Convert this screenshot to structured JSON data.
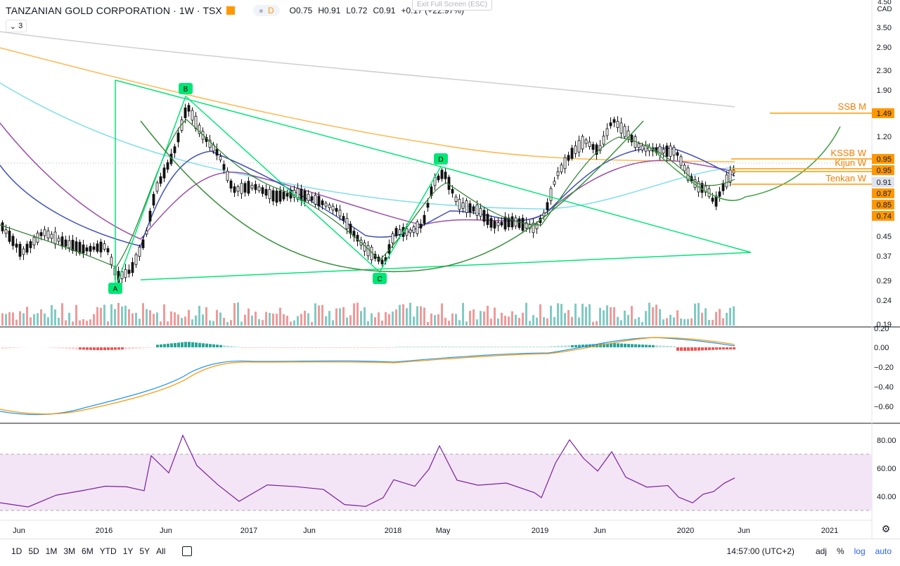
{
  "header": {
    "symbol": "TANZANIAN GOLD CORPORATION",
    "interval": "1W",
    "exchange": "TSX",
    "delay_badge": "D",
    "open_label": "O",
    "open": "0.75",
    "high_label": "H",
    "high": "0.91",
    "low_label": "L",
    "low": "0.72",
    "close_label": "C",
    "close": "0.91",
    "change": "+0.17 (+22.97%)",
    "collapse_count": "3"
  },
  "exit_fullscreen": "Exit Full Screen (ESC)",
  "price_axis": {
    "currency": "CAD",
    "top_label": "4.50",
    "ticks": [
      "3.50",
      "2.90",
      "2.30",
      "1.90",
      "1.49",
      "1.20",
      "0.95",
      "0.95",
      "0.91",
      "0.87",
      "0.85",
      "0.74",
      "0.45",
      "0.37",
      "0.29",
      "0.24",
      "0.19"
    ]
  },
  "level_labels": [
    {
      "text": "SSB M",
      "color": "#f57c00"
    },
    {
      "text": "KSSB W",
      "color": "#f57c00"
    },
    {
      "text": "Kijun W",
      "color": "#f57c00"
    },
    {
      "text": "Tenkan W",
      "color": "#f57c00"
    }
  ],
  "price_badges": [
    {
      "text": "1.49",
      "bg": "#ff9800",
      "fg": "#000"
    },
    {
      "text": "0.95",
      "bg": "#ff9800",
      "fg": "#000"
    },
    {
      "text": "0.95",
      "bg": "#ff9800",
      "fg": "#000"
    },
    {
      "text": "0.91",
      "bg": "#e0e3eb",
      "fg": "#131722"
    },
    {
      "text": "0.87",
      "bg": "#ff9800",
      "fg": "#000"
    },
    {
      "text": "0.85",
      "bg": "#ff9800",
      "fg": "#000"
    },
    {
      "text": "0.74",
      "bg": "#ff9800",
      "fg": "#000"
    }
  ],
  "macd_axis": [
    "0.20",
    "0.00",
    "−0.20",
    "−0.40",
    "−0.60"
  ],
  "rsi_axis": [
    "80.00",
    "60.00",
    "40.00"
  ],
  "time_axis": [
    "Jun",
    "2016",
    "Jun",
    "2017",
    "Jun",
    "2018",
    "May",
    "2019",
    "Jun",
    "2020",
    "Jun",
    "2021"
  ],
  "pattern_points": [
    "A",
    "B",
    "C",
    "D"
  ],
  "toolbar": {
    "ranges": [
      "1D",
      "5D",
      "1M",
      "3M",
      "6M",
      "YTD",
      "1Y",
      "5Y",
      "All"
    ],
    "time": "14:57:00 (UTC+2)",
    "adj": "adj",
    "percent": "%",
    "log": "log",
    "auto": "auto"
  },
  "colors": {
    "up": "#26a69a",
    "down": "#ef5350",
    "pattern": "#00e676",
    "orange": "#ff9800",
    "rsi_band": "#f3e5f5",
    "rsi_line": "#7b1fa2"
  }
}
